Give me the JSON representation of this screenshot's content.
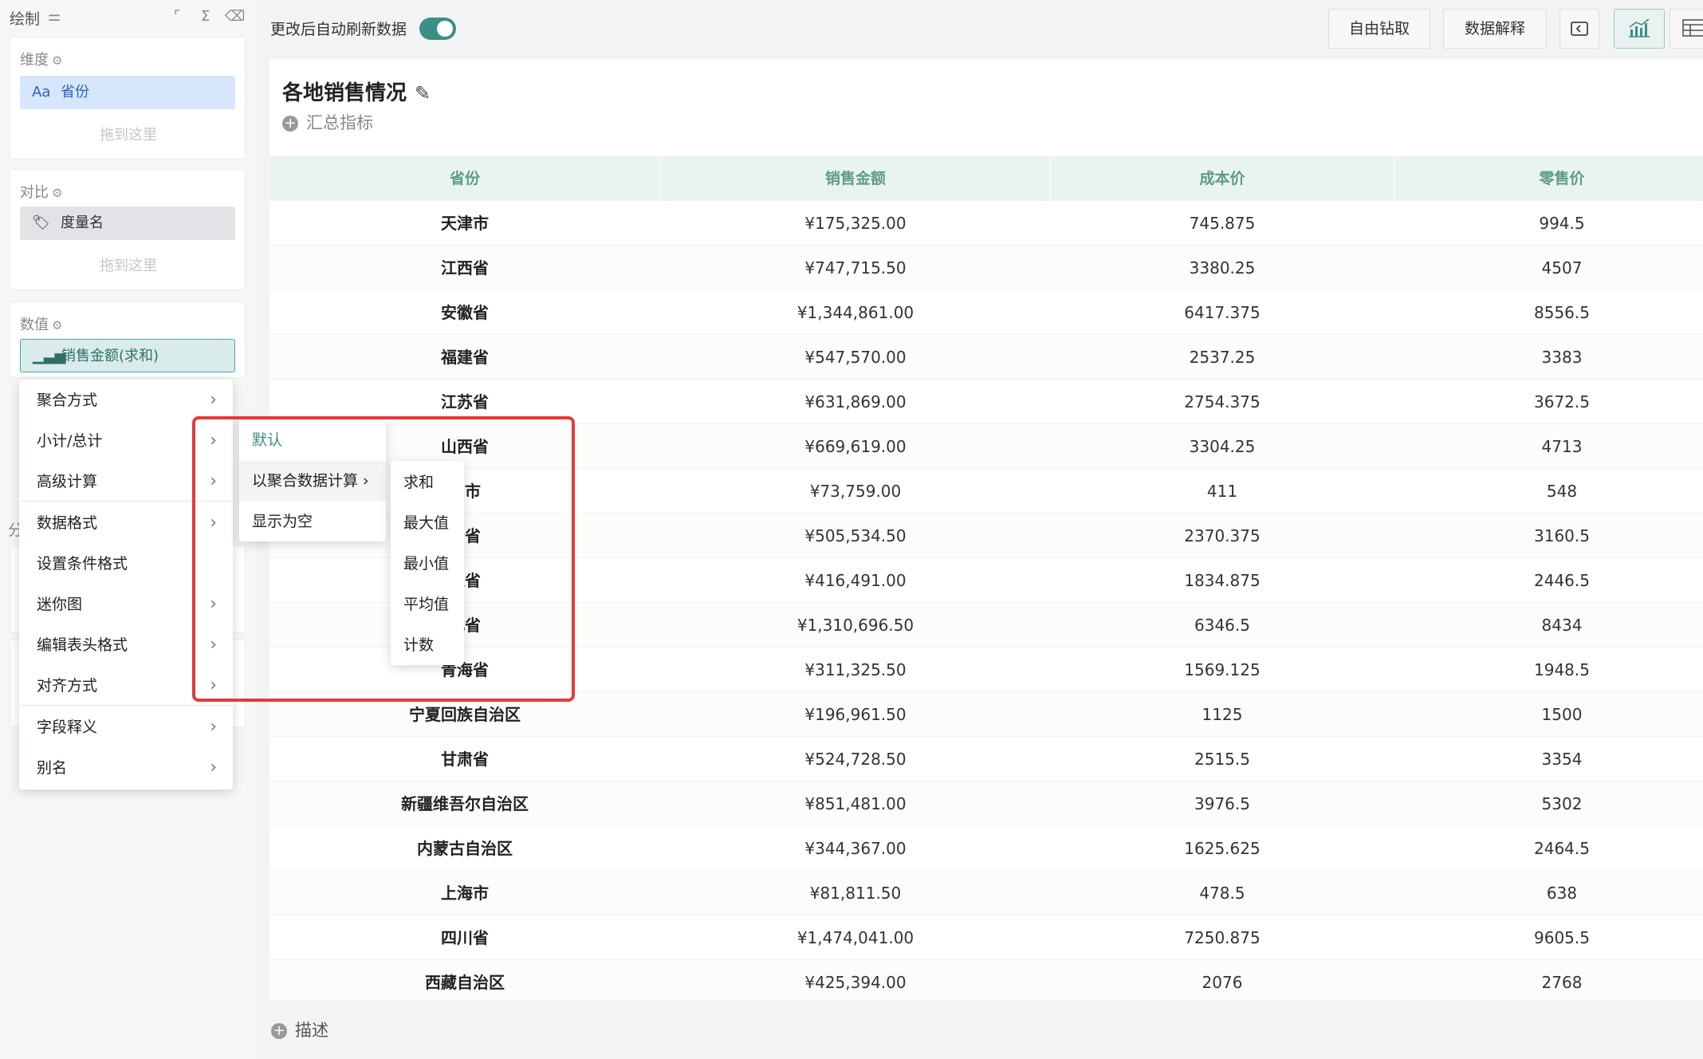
{
  "left_panel": {
    "title": "绘制",
    "dimension": {
      "label": "维度",
      "field": "省份",
      "field_icon": "Aa",
      "drop_hint": "拖到这里"
    },
    "compare": {
      "label": "对比",
      "field": "度量名",
      "drop_hint": "拖到这里"
    },
    "value": {
      "label": "数值",
      "field": "销售金额(求和)"
    },
    "hidden_section_label": "分"
  },
  "context_menu": {
    "items": [
      {
        "label": "聚合方式",
        "chevron": "›"
      },
      {
        "label": "小计/总计",
        "chevron": "›"
      },
      {
        "label": "高级计算",
        "chevron": "›"
      },
      {
        "label": "数据格式",
        "chevron": "›"
      },
      {
        "label": "设置条件格式",
        "chevron": ""
      },
      {
        "label": "迷你图",
        "chevron": "›"
      },
      {
        "label": "编辑表头格式",
        "chevron": "›"
      },
      {
        "label": "对齐方式",
        "chevron": "›"
      },
      {
        "label": "字段释义",
        "chevron": "›"
      },
      {
        "label": "别名",
        "chevron": "›"
      }
    ]
  },
  "submenu": {
    "items": [
      {
        "label": "默认"
      },
      {
        "label": "以聚合数据计算 ›"
      },
      {
        "label": "显示为空"
      }
    ],
    "active_color": "#3e8f86"
  },
  "submenu2": {
    "items": [
      {
        "label": "求和"
      },
      {
        "label": "最大值"
      },
      {
        "label": "最小值"
      },
      {
        "label": "平均值"
      },
      {
        "label": "计数"
      }
    ]
  },
  "toolbar": {
    "auto_refresh_label": "更改后自动刷新数据",
    "auto_refresh_on": true,
    "drill_label": "自由钻取",
    "explain_label": "数据解释",
    "accent": "#3b8f86"
  },
  "card": {
    "title": "各地销售情况",
    "summary_label": "汇总指标",
    "description_label": "描述"
  },
  "table": {
    "columns": [
      "省份",
      "销售金额",
      "成本价",
      "零售价"
    ],
    "rows": [
      [
        "天津市",
        "¥175,325.00",
        "745.875",
        "994.5"
      ],
      [
        "江西省",
        "¥747,715.50",
        "3380.25",
        "4507"
      ],
      [
        "安徽省",
        "¥1,344,861.00",
        "6417.375",
        "8556.5"
      ],
      [
        "福建省",
        "¥547,570.00",
        "2537.25",
        "3383"
      ],
      [
        "江苏省",
        "¥631,869.00",
        "2754.375",
        "3672.5"
      ],
      [
        "山西省",
        "¥669,619.00",
        "3304.25",
        "4713"
      ],
      [
        "京市",
        "¥73,759.00",
        "411",
        "548"
      ],
      [
        "州省",
        "¥505,534.50",
        "2370.375",
        "3160.5"
      ],
      [
        "工省",
        "¥416,491.00",
        "1834.875",
        "2446.5"
      ],
      [
        "北省",
        "¥1,310,696.50",
        "6346.5",
        "8434"
      ],
      [
        "青海省",
        "¥311,325.50",
        "1569.125",
        "1948.5"
      ],
      [
        "宁夏回族自治区",
        "¥196,961.50",
        "1125",
        "1500"
      ],
      [
        "甘肃省",
        "¥524,728.50",
        "2515.5",
        "3354"
      ],
      [
        "新疆维吾尔自治区",
        "¥851,481.00",
        "3976.5",
        "5302"
      ],
      [
        "内蒙古自治区",
        "¥344,367.00",
        "1625.625",
        "2464.5"
      ],
      [
        "上海市",
        "¥81,811.50",
        "478.5",
        "638"
      ],
      [
        "四川省",
        "¥1,474,041.00",
        "7250.875",
        "9605.5"
      ],
      [
        "西藏自治区",
        "¥425,394.00",
        "2076",
        "2768"
      ]
    ],
    "header_bg": "#e9f4ee",
    "header_color": "#5e9b8a"
  },
  "highlight_color": "#e43a3a"
}
